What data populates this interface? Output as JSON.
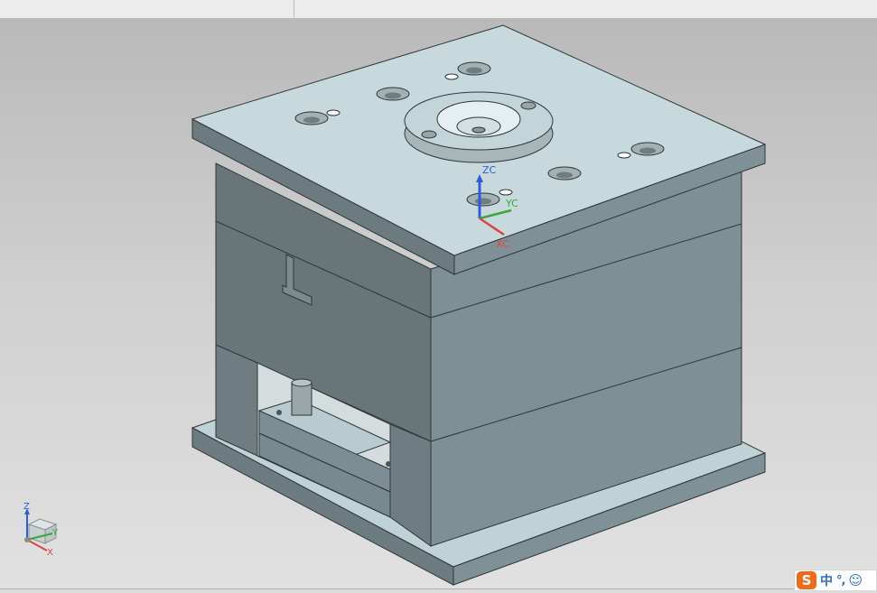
{
  "viewport": {
    "workcs_axes": {
      "z_label": "ZC",
      "y_label": "YC",
      "x_label": "XC"
    },
    "absolute_triad": {
      "z_label": "Z",
      "y_label": "Y",
      "x_label": "X"
    }
  },
  "ime_bar": {
    "logo": "S",
    "mode": "中",
    "punct": "°,",
    "emoji": "☺"
  },
  "colors": {
    "plate_top": "#c7d9dd",
    "plate_front": "#7d8e94",
    "plate_left": "#6c7b80",
    "zc_axis": "#2e5bd9",
    "yc_axis": "#3aa63a",
    "xc_axis": "#d94444",
    "ime_orange": "#f06a1d"
  }
}
